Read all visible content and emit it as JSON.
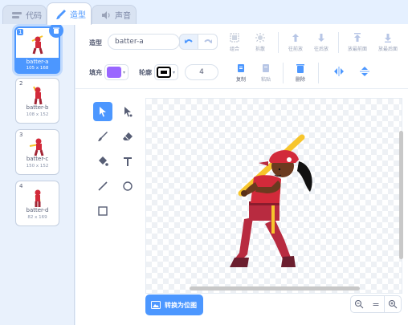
{
  "tabs": {
    "code": "代码",
    "costumes": "造型",
    "sounds": "声音"
  },
  "costumes": [
    {
      "num": "1",
      "name": "batter-a",
      "size": "105 x 168"
    },
    {
      "num": "2",
      "name": "batter-b",
      "size": "108 x 152"
    },
    {
      "num": "3",
      "name": "batter-c",
      "size": "150 x 152"
    },
    {
      "num": "4",
      "name": "batter-d",
      "size": "82 x 169"
    }
  ],
  "toolbar": {
    "costume_label": "造型",
    "costume_name": "batter-a",
    "group": "组合",
    "ungroup": "拆散",
    "forward": "往前放",
    "backward": "往后放",
    "front": "放最前面",
    "back": "放最后面",
    "fill_label": "填充",
    "outline_label": "轮廓",
    "outline_width": "4",
    "copy": "复制",
    "paste": "粘贴",
    "delete": "删除"
  },
  "colors": {
    "accent": "#4c97ff",
    "fill": "#9966ff",
    "outline": "#000000"
  },
  "convert_button": "转换为位图",
  "zoom": {
    "zoom_out": "−",
    "reset": "=",
    "zoom_in": "+"
  },
  "icons": [
    "code-icon",
    "brush-icon",
    "speaker-icon",
    "trash-icon",
    "undo-icon",
    "redo-icon",
    "select-icon",
    "reshape-icon",
    "brush-tool-icon",
    "eraser-icon",
    "fill-icon",
    "text-icon",
    "line-icon",
    "circle-icon",
    "rectangle-icon",
    "flip-horizontal-icon",
    "flip-vertical-icon",
    "image-icon"
  ]
}
